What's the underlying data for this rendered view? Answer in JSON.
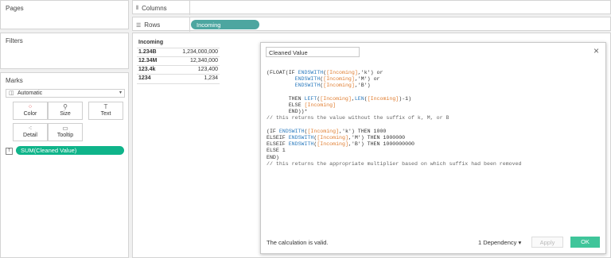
{
  "left_panel": {
    "pages_title": "Pages",
    "filters_title": "Filters",
    "marks_title": "Marks",
    "mark_type": "Automatic",
    "buttons": [
      {
        "label": "Color",
        "icon": "color-dots-icon"
      },
      {
        "label": "Size",
        "icon": "size-icon"
      },
      {
        "label": "Text",
        "icon": "text-icon"
      },
      {
        "label": "Detail",
        "icon": "detail-icon"
      },
      {
        "label": "Tooltip",
        "icon": "tooltip-icon"
      }
    ],
    "mark_pill": "SUM(Cleaned Value)"
  },
  "shelves": {
    "columns_label": "Columns",
    "rows_label": "Rows",
    "rows_pill": "Incoming"
  },
  "table": {
    "header": "Incoming",
    "rows": [
      {
        "label": "1.234B",
        "value": "1,234,000,000"
      },
      {
        "label": "12.34M",
        "value": "12,340,000"
      },
      {
        "label": "123.4k",
        "value": "123,400"
      },
      {
        "label": "1234",
        "value": "1,234"
      }
    ]
  },
  "dialog": {
    "name": "Cleaned Value",
    "status": "The calculation is valid.",
    "dependency": "1 Dependency ▾",
    "apply": "Apply",
    "ok": "OK",
    "close": "×",
    "lines": {
      "l1a": "(FLOAT(IF ",
      "l1b": "ENDSWITH",
      "l1c": "(",
      "l1d": "[Incoming]",
      "l1e": ",'k') or",
      "l2a": "         ",
      "l2b": "ENDSWITH",
      "l2c": "(",
      "l2d": "[Incoming]",
      "l2e": ",'M') or",
      "l3a": "         ",
      "l3b": "ENDSWITH",
      "l3c": "(",
      "l3d": "[Incoming]",
      "l3e": ",'B')",
      "l5a": "       THEN ",
      "l5b": "LEFT",
      "l5c": "(",
      "l5d": "[Incoming]",
      "l5e": ",",
      "l5f": "LEN",
      "l5g": "(",
      "l5h": "[Incoming]",
      "l5i": ")-1)",
      "l6a": "       ELSE ",
      "l6b": "[Incoming]",
      "l7a": "       END))*",
      "l8": "// this returns the value without the suffix of k, M, or B",
      "l10a": "(IF ",
      "l10b": "ENDSWITH",
      "l10c": "(",
      "l10d": "[Incoming]",
      "l10e": ",'k') THEN 1000",
      "l11a": "ELSEIF ",
      "l11b": "ENDSWITH",
      "l11c": "(",
      "l11d": "[Incoming]",
      "l11e": ",'M') THEN 1000000",
      "l12a": "ELSEIF ",
      "l12b": "ENDSWITH",
      "l12c": "(",
      "l12d": "[Incoming]",
      "l12e": ",'B') THEN 1000000000",
      "l13": "ELSE 1",
      "l14": "END)",
      "l15": "// this returns the appropriate multiplier based on which suffix had been removed"
    }
  },
  "colors": {
    "teal_pill": "#4da6a0",
    "green_pill": "#0fb48a",
    "field": "#e07c2e",
    "function": "#2f7dbf"
  }
}
